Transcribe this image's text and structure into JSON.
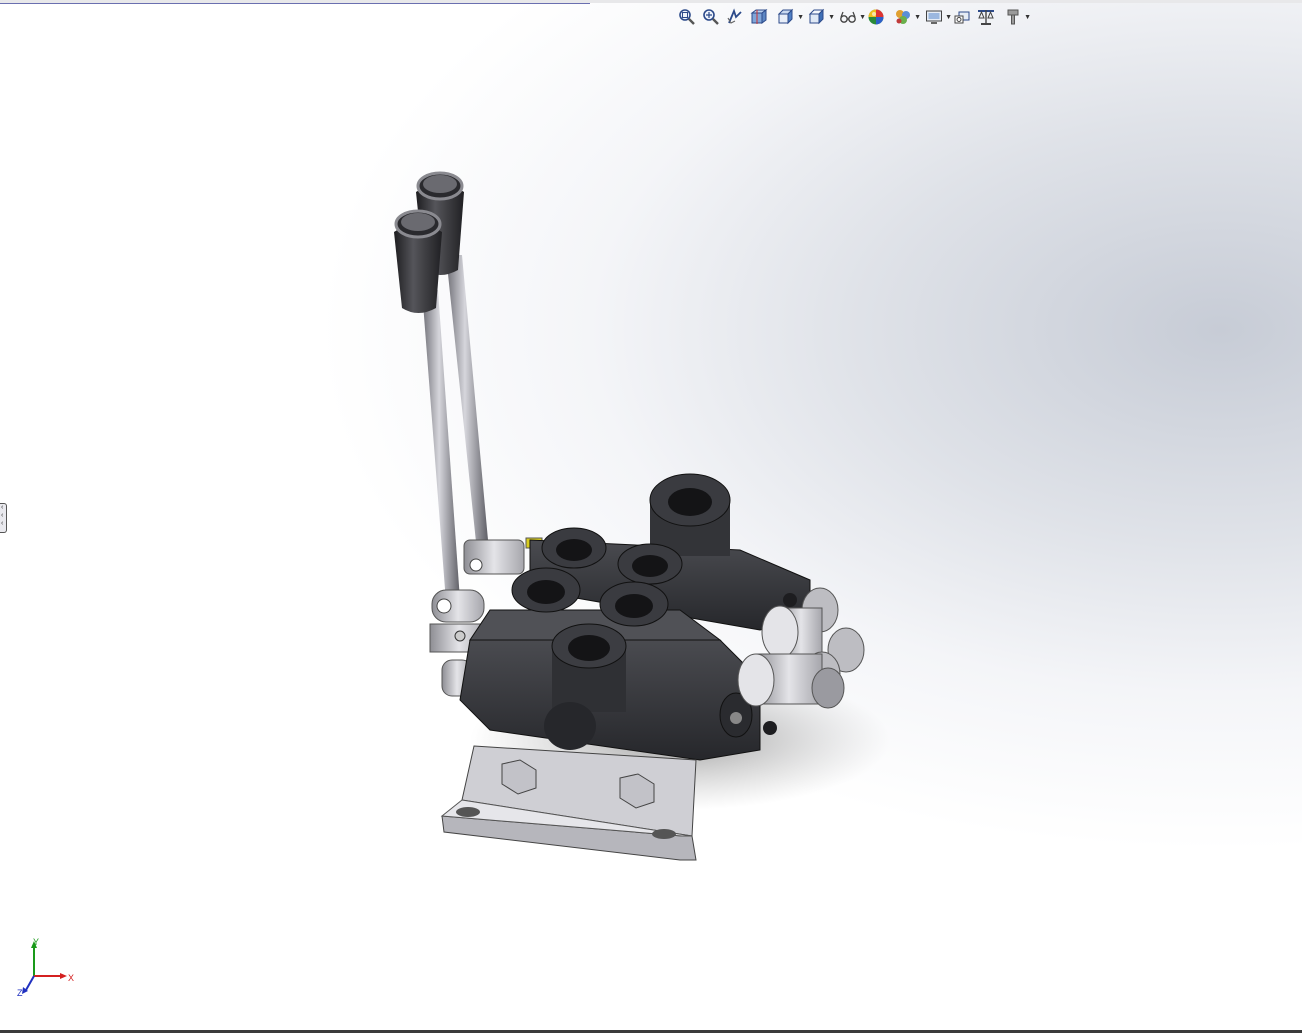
{
  "window": {
    "colors": {
      "bg_center": "#c7ccd6",
      "bg_edge": "#ffffff",
      "bottom_border": "#3b3b3b"
    }
  },
  "heads_up_toolbar": {
    "items": [
      {
        "name": "zoom-to-fit",
        "icon": "magnifier-fit-icon"
      },
      {
        "name": "zoom-to-area",
        "icon": "magnifier-area-icon"
      },
      {
        "name": "previous-view",
        "icon": "previous-view-icon"
      },
      {
        "name": "section-view",
        "icon": "section-view-icon"
      },
      {
        "name": "view-orientation",
        "icon": "cube-orientation-icon",
        "dropdown": true
      },
      {
        "name": "display-style",
        "icon": "shaded-cube-icon",
        "dropdown": true
      },
      {
        "name": "hide-show-items",
        "icon": "eye-glasses-icon",
        "dropdown": true
      },
      {
        "name": "edit-appearance",
        "icon": "color-ball-icon"
      },
      {
        "name": "apply-scene",
        "icon": "scene-icon",
        "dropdown": true
      },
      {
        "name": "view-settings",
        "icon": "monitor-icon",
        "dropdown": true
      },
      {
        "name": "rotate-view",
        "icon": "rotate-icon"
      },
      {
        "name": "measure",
        "icon": "balance-icon"
      },
      {
        "name": "more-options",
        "icon": "pin-icon",
        "dropdown": true
      }
    ]
  },
  "side_panel_toggle": {
    "icon": "collapse-arrows-icon"
  },
  "triad": {
    "x_label": "X",
    "y_label": "Y",
    "z_label": "Z",
    "colors": {
      "x": "#d42020",
      "y": "#1a9a1a",
      "z": "#2030c0"
    }
  },
  "model": {
    "name": "hydraulic-directional-control-valve-2-section"
  }
}
